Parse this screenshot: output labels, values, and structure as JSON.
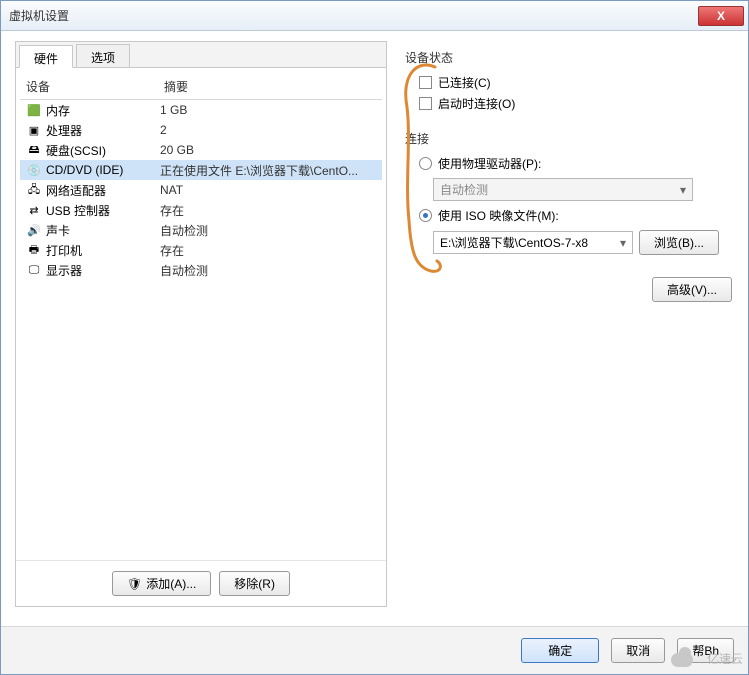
{
  "window": {
    "title": "虚拟机设置",
    "close_glyph": "X"
  },
  "tabs": {
    "hardware": "硬件",
    "options": "选项"
  },
  "columns": {
    "device": "设备",
    "summary": "摘要"
  },
  "devices": [
    {
      "icon": "🟩",
      "icon_name": "memory-icon",
      "name": "内存",
      "summary": "1 GB"
    },
    {
      "icon": "▣",
      "icon_name": "cpu-icon",
      "name": "处理器",
      "summary": "2"
    },
    {
      "icon": "🖴",
      "icon_name": "hdd-icon",
      "name": "硬盘(SCSI)",
      "summary": "20 GB"
    },
    {
      "icon": "💿",
      "icon_name": "cd-icon",
      "name": "CD/DVD (IDE)",
      "summary": "正在使用文件 E:\\浏览器下载\\CentO..."
    },
    {
      "icon": "🖧",
      "icon_name": "nic-icon",
      "name": "网络适配器",
      "summary": "NAT"
    },
    {
      "icon": "⇄",
      "icon_name": "usb-icon",
      "name": "USB 控制器",
      "summary": "存在"
    },
    {
      "icon": "🔊",
      "icon_name": "sound-icon",
      "name": "声卡",
      "summary": "自动检测"
    },
    {
      "icon": "🖶",
      "icon_name": "printer-icon",
      "name": "打印机",
      "summary": "存在"
    },
    {
      "icon": "🖵",
      "icon_name": "display-icon",
      "name": "显示器",
      "summary": "自动检测"
    }
  ],
  "selected_device_index": 3,
  "left_footer": {
    "add": "添加(A)...",
    "remove": "移除(R)",
    "shield_glyph": "🛡"
  },
  "status_group": {
    "title": "设备状态",
    "connected": "已连接(C)",
    "connect_at_poweron": "启动时连接(O)"
  },
  "conn_group": {
    "title": "连接",
    "physical": "使用物理驱动器(P):",
    "physical_value": "自动检测",
    "iso": "使用 ISO 映像文件(M):",
    "iso_value": "E:\\浏览器下载\\CentOS-7-x8",
    "browse": "浏览(B)...",
    "caret": "▾"
  },
  "advanced": "高级(V)...",
  "footer": {
    "ok": "确定",
    "cancel": "取消",
    "help": "帮Bh"
  },
  "watermark": "亿速云",
  "colors": {
    "selection": "#cfe3f8",
    "accent": "#3373c8",
    "annotation": "#d83"
  }
}
